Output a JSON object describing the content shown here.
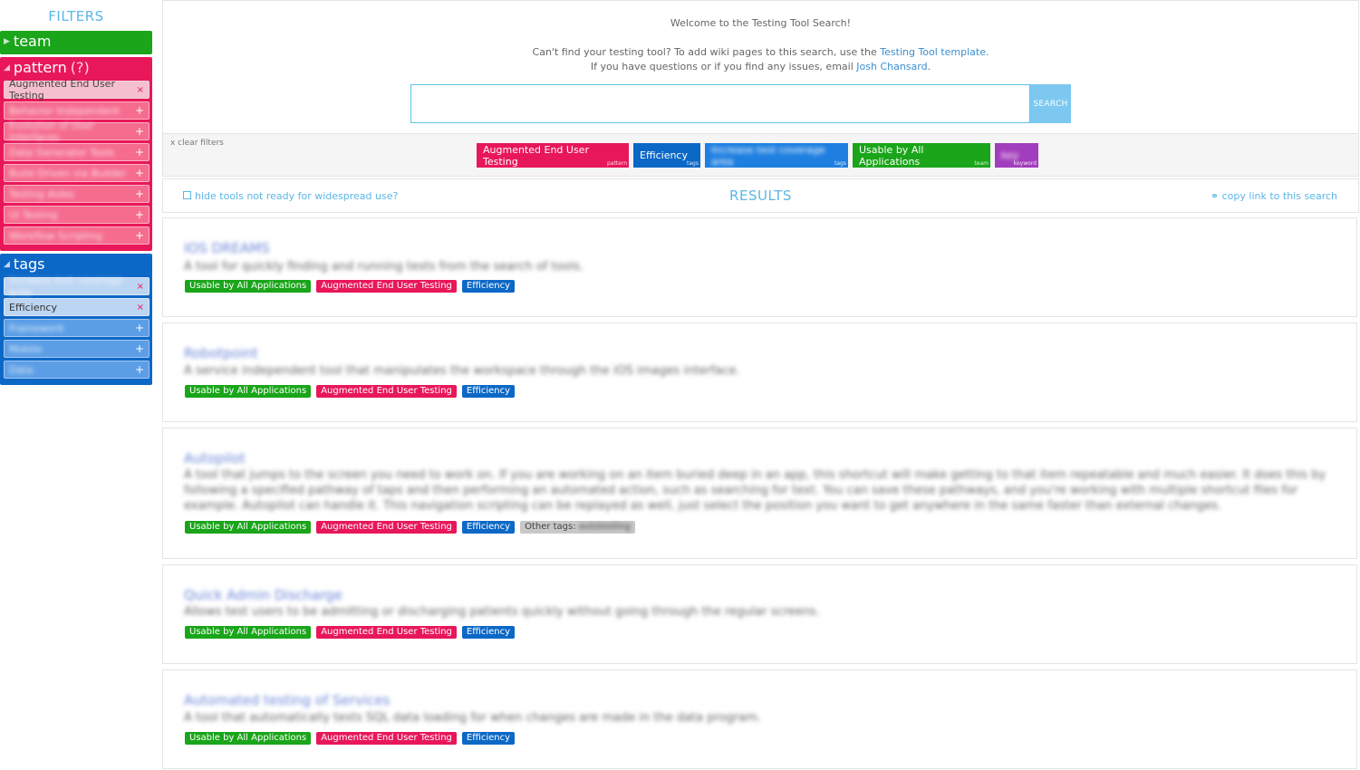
{
  "sidebar": {
    "title": "FILTERS",
    "team": {
      "label": "team"
    },
    "pattern": {
      "label": "pattern",
      "help": "(?)",
      "items": [
        {
          "label": "Augmented End User Testing",
          "mark": "×",
          "selected": true
        },
        {
          "label": "Behavior Independent",
          "mark": "+"
        },
        {
          "label": "Evolution of User Interfaces",
          "mark": "+"
        },
        {
          "label": "Data Generator Tools",
          "mark": "+"
        },
        {
          "label": "Build Driven via Builder",
          "mark": "+"
        },
        {
          "label": "Testing Aides",
          "mark": "+"
        },
        {
          "label": "UI Testing",
          "mark": "+"
        },
        {
          "label": "Workflow Scripting",
          "mark": "+"
        }
      ]
    },
    "tags": {
      "label": "tags",
      "items": [
        {
          "label": "Increase test coverage area",
          "mark": "×",
          "selected": true
        },
        {
          "label": "Efficiency",
          "mark": "×",
          "selected": true
        },
        {
          "label": "Framework",
          "mark": "+"
        },
        {
          "label": "Mobile",
          "mark": "+"
        },
        {
          "label": "Data",
          "mark": "+"
        }
      ]
    }
  },
  "welcome": {
    "line1": "Welcome to the Testing Tool Search!",
    "line2_pre": "Can't find your testing tool? To add wiki pages to this search, use the ",
    "line2_link": "Testing Tool template",
    "line2_post": ".",
    "line3_pre": "If you have questions or if you find any issues, email ",
    "line3_link": "Josh Chansard",
    "line3_post": "."
  },
  "search": {
    "placeholder": "",
    "value": "",
    "button_label": "SEARCH"
  },
  "active_filters": {
    "clear_label": "x clear filters",
    "chips": [
      {
        "label": "Augmented End User Testing",
        "type": "pattern"
      },
      {
        "label": "Efficiency",
        "type": "tags"
      },
      {
        "label": "Increase test coverage area",
        "type": "tags"
      },
      {
        "label": "Usable by All Applications",
        "type": "team"
      },
      {
        "label": "key",
        "type": "keyword"
      }
    ]
  },
  "results_bar": {
    "hide_label": "hide tools not ready for widespread use?",
    "title": "RESULTS",
    "copy_label": "copy link to this search",
    "copy_icon": "link-icon"
  },
  "results": [
    {
      "title": "IOS DREAMS",
      "desc": "A tool for quickly finding and running tests from the search of tools.",
      "badges": [
        "Usable by All Applications",
        "Augmented End User Testing",
        "Efficiency"
      ]
    },
    {
      "title": "Robotpoint",
      "desc": "A service independent tool that manipulates the workspace through the iOS images interface.",
      "badges": [
        "Usable by All Applications",
        "Augmented End User Testing",
        "Efficiency"
      ]
    },
    {
      "title": "Autopilot",
      "desc": "A tool that jumps to the screen you need to work on. If you are working on an item buried deep in an app, this shortcut will make getting to that item repeatable and much easier. It does this by following a specified pathway of taps and then performing an automated action, such as searching for text. You can save these pathways, and you're working with multiple shortcut files for example. Autopilot can handle it. This navigation scripting can be replayed as well, just select the position you want to get anywhere in the same faster than external changes.",
      "badges": [
        "Usable by All Applications",
        "Augmented End User Testing",
        "Efficiency"
      ],
      "other_label": "Other tags:",
      "other_value": "autotesting"
    },
    {
      "title": "Quick Admin Discharge",
      "desc": "Allows test users to be admitting or discharging patients quickly without going through the regular screens.",
      "badges": [
        "Usable by All Applications",
        "Augmented End User Testing",
        "Efficiency"
      ]
    },
    {
      "title": "Automated testing of Services",
      "desc": "A tool that automatically tests SQL data loading for when changes are made in the data program.",
      "badges": [
        "Usable by All Applications",
        "Augmented End User Testing",
        "Efficiency"
      ]
    }
  ]
}
